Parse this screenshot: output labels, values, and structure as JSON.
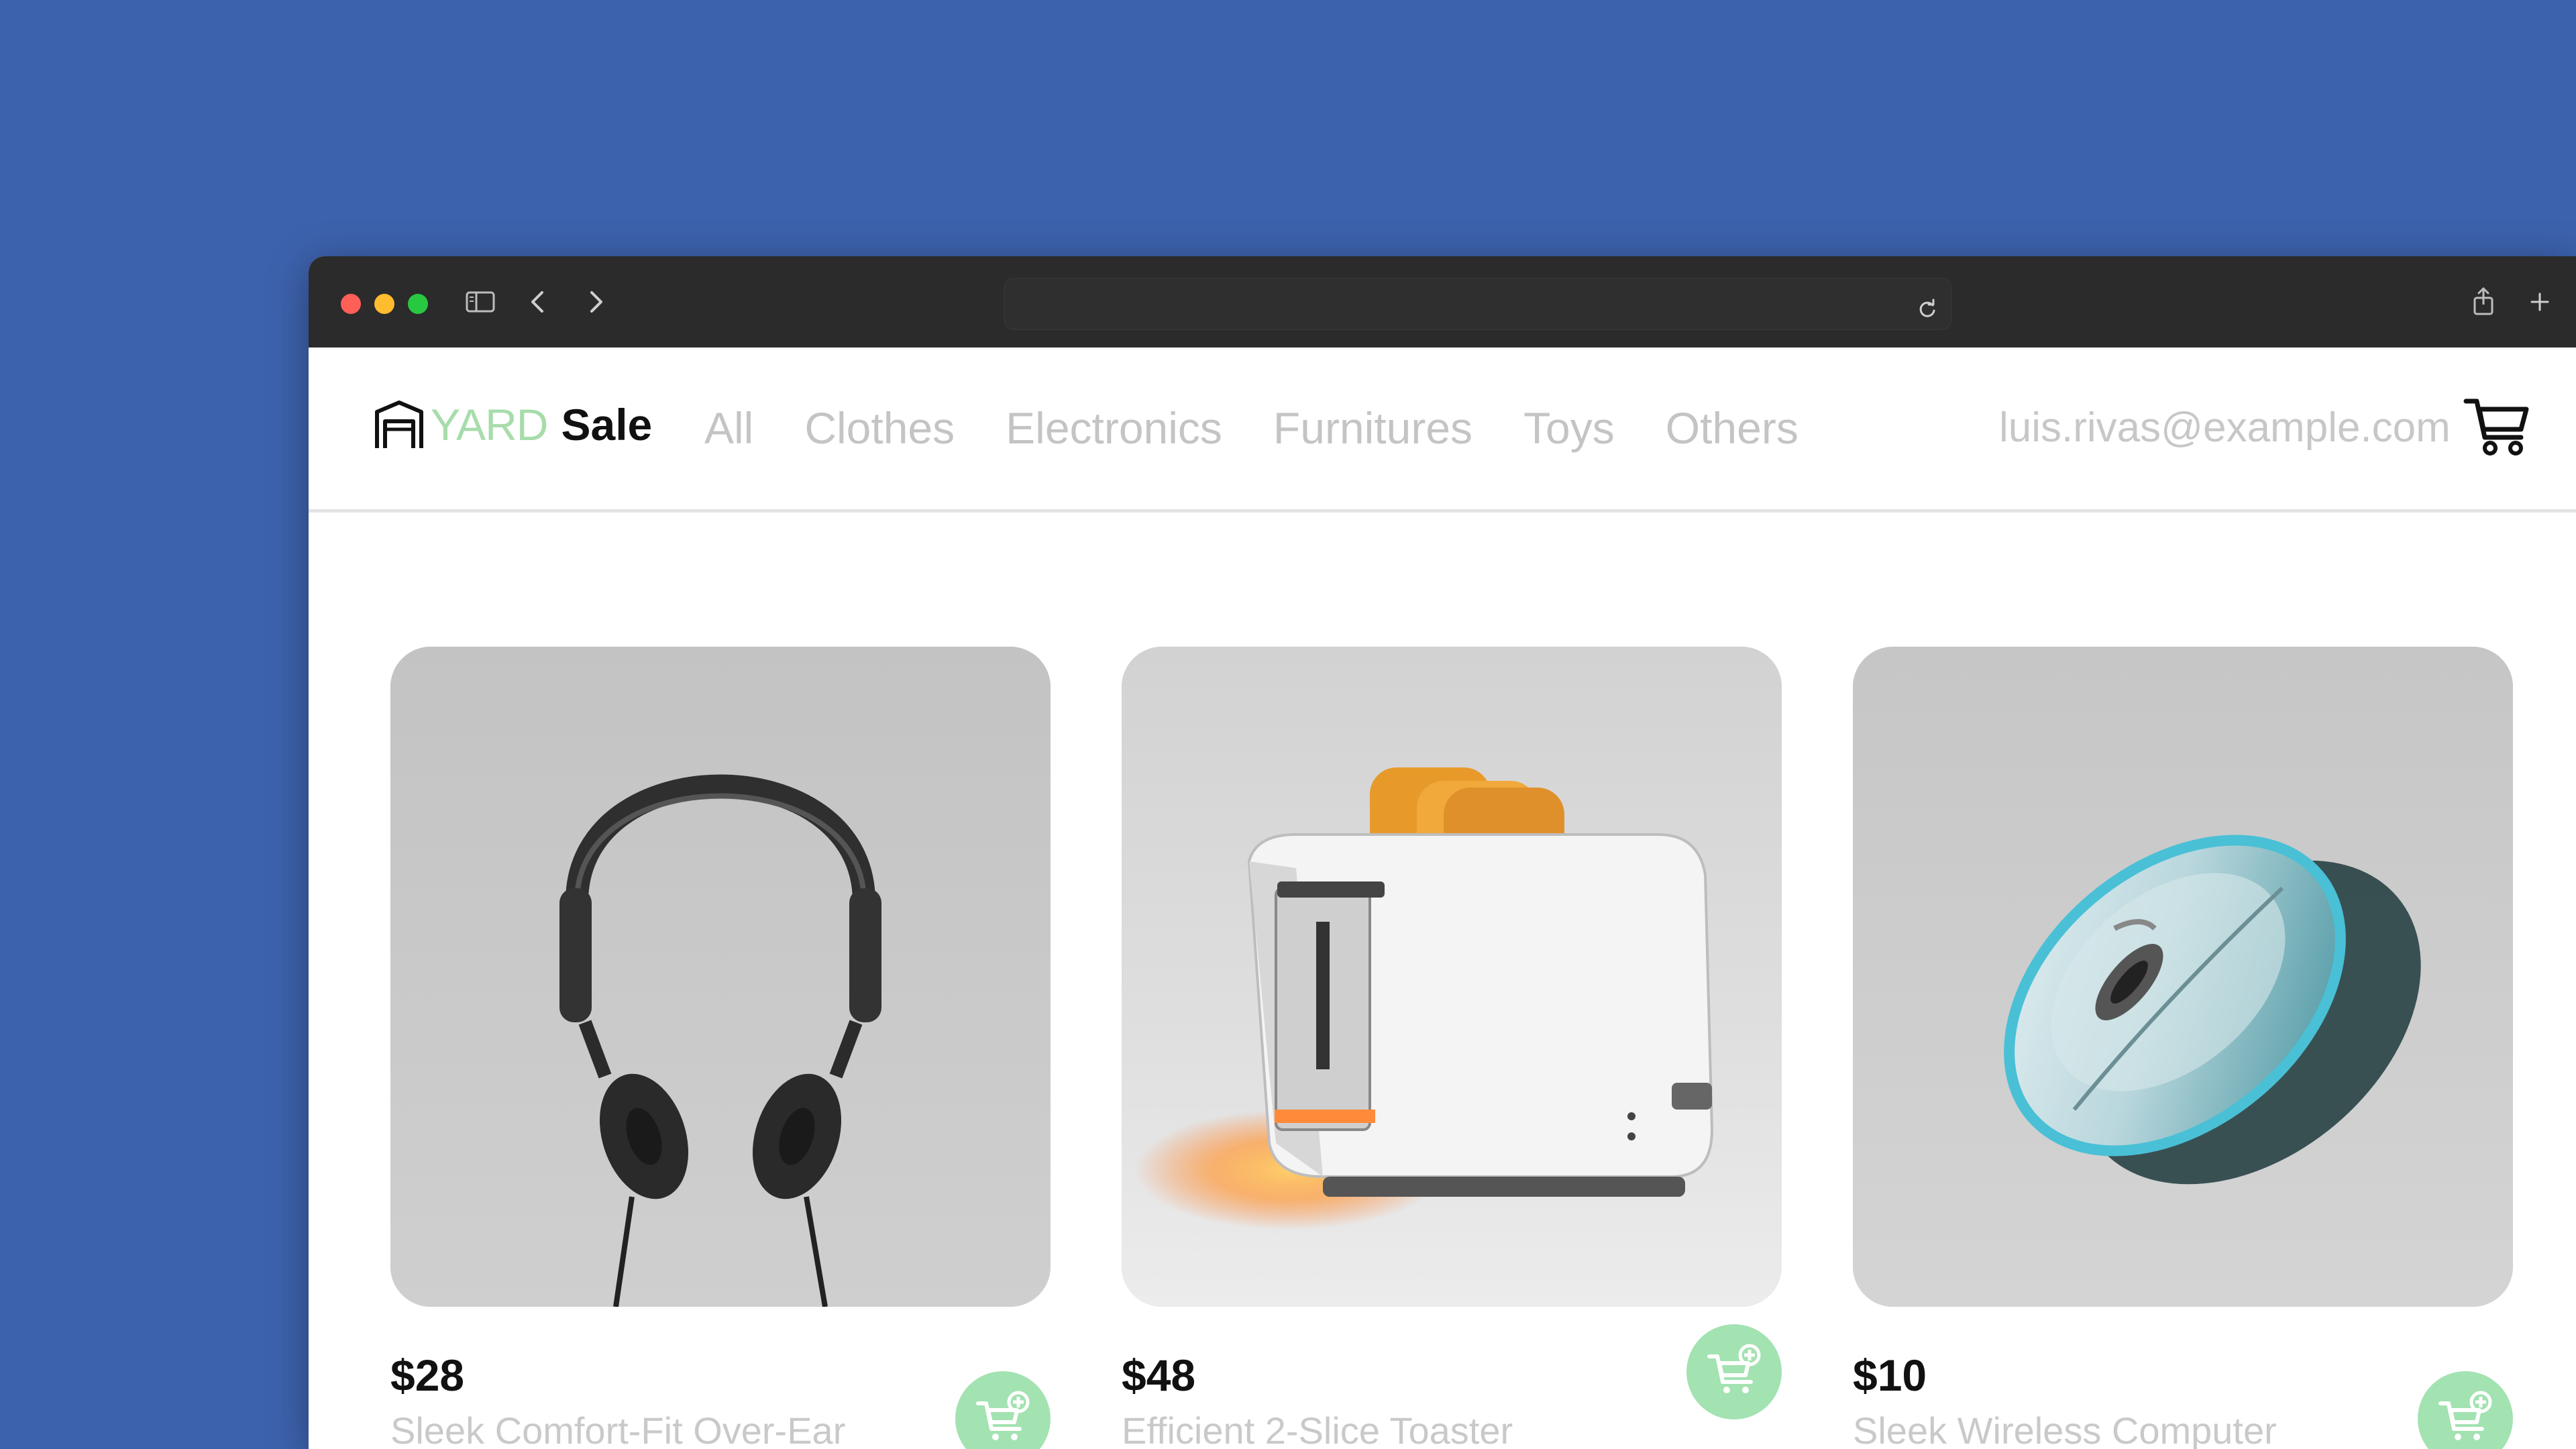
{
  "browser": {
    "address_text": ""
  },
  "header": {
    "logo_yard": "YARD",
    "logo_sale": "Sale",
    "nav": [
      {
        "label": "All"
      },
      {
        "label": "Clothes"
      },
      {
        "label": "Electronics"
      },
      {
        "label": "Furnitures"
      },
      {
        "label": "Toys"
      },
      {
        "label": "Others"
      }
    ],
    "user_email": "luis.rivas@example.com"
  },
  "products": [
    {
      "price": "$28",
      "name": "Sleek Comfort-Fit Over-Ear",
      "image": "headphones"
    },
    {
      "price": "$48",
      "name": "Efficient 2-Slice Toaster",
      "image": "toaster"
    },
    {
      "price": "$10",
      "name": "Sleek Wireless Computer",
      "image": "wireless-mouse"
    }
  ],
  "colors": {
    "background": "#3d62ad",
    "titlebar": "#2b2b2b",
    "logo_yard": "#a7dcab",
    "add_button": "#a3e2b1",
    "nav_text": "#c4c4c4"
  }
}
